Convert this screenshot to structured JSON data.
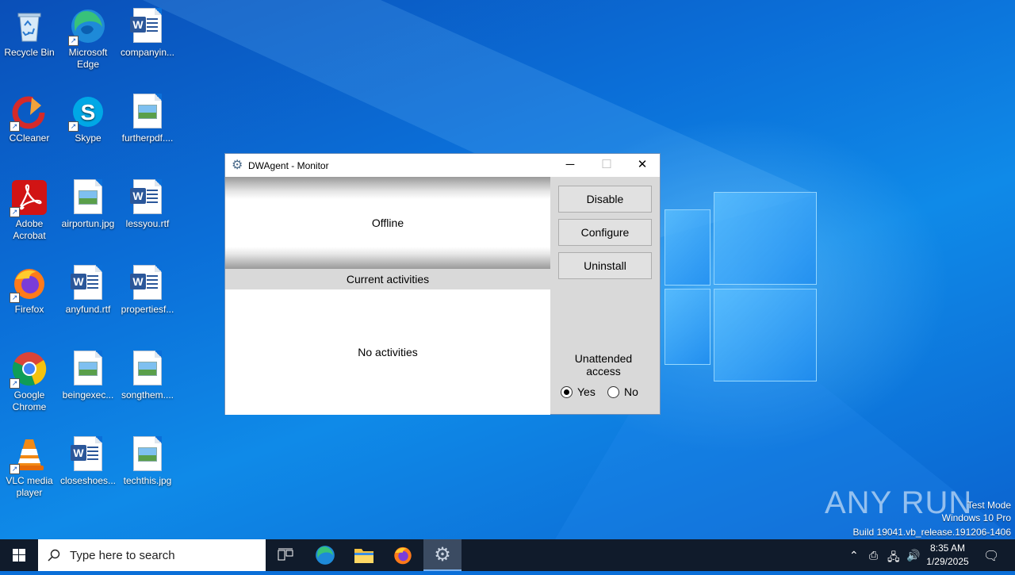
{
  "desktop": {
    "icons": [
      {
        "label": "Recycle Bin"
      },
      {
        "label": "Microsoft Edge"
      },
      {
        "label": "companyin..."
      },
      {
        "label": "CCleaner"
      },
      {
        "label": "Skype"
      },
      {
        "label": "furtherpdf...."
      },
      {
        "label": "Adobe Acrobat"
      },
      {
        "label": "airportun.jpg"
      },
      {
        "label": "lessyou.rtf"
      },
      {
        "label": "Firefox"
      },
      {
        "label": "anyfund.rtf"
      },
      {
        "label": "propertiesf..."
      },
      {
        "label": "Google Chrome"
      },
      {
        "label": "beingexec..."
      },
      {
        "label": "songthem...."
      },
      {
        "label": "VLC media player"
      },
      {
        "label": "closeshoes..."
      },
      {
        "label": "techthis.jpg"
      }
    ]
  },
  "dialog": {
    "title": "DWAgent - Monitor",
    "status": "Offline",
    "activities_header": "Current activities",
    "activities_text": "No activities",
    "buttons": {
      "disable": "Disable",
      "configure": "Configure",
      "uninstall": "Uninstall"
    },
    "unattended_label": "Unattended access",
    "radio_yes": "Yes",
    "radio_no": "No",
    "unattended_selected": "Yes"
  },
  "watermark": {
    "brand": "ANY RUN",
    "line1": "Test Mode",
    "line2": "Windows 10 Pro",
    "line3": "Build 19041.vb_release.191206-1406"
  },
  "taskbar": {
    "search_placeholder": "Type here to search",
    "time": "8:35 AM",
    "date": "1/29/2025"
  },
  "colors": {
    "desktop_blue": "#0b6fd8",
    "taskbar": "#101b2b",
    "dialog_bg": "#d9d9d9"
  }
}
